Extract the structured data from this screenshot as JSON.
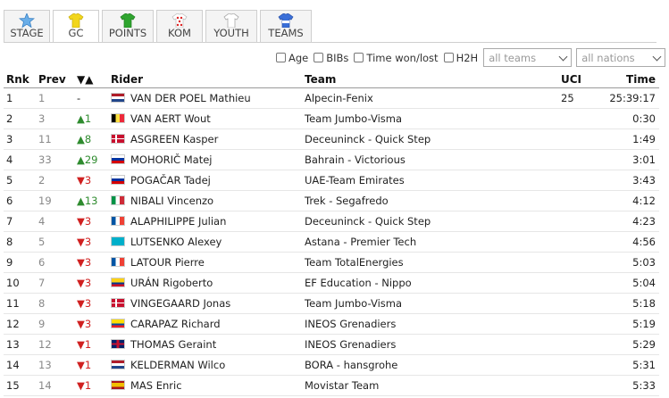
{
  "tabs": [
    {
      "label": "STAGE",
      "icon": "star-icon",
      "active": false
    },
    {
      "label": "GC",
      "icon": "yellow-jersey-icon",
      "active": true
    },
    {
      "label": "POINTS",
      "icon": "green-jersey-icon",
      "active": false
    },
    {
      "label": "KOM",
      "icon": "polka-dot-jersey-icon",
      "active": false
    },
    {
      "label": "YOUTH",
      "icon": "white-jersey-icon",
      "active": false
    },
    {
      "label": "TEAMS",
      "icon": "blue-jersey-icon",
      "active": false
    }
  ],
  "filters": {
    "age": "Age",
    "bibs": "BIBs",
    "time_won_lost": "Time won/lost",
    "h2h": "H2H",
    "teams_select": "all teams",
    "nations_select": "all nations"
  },
  "headers": {
    "rnk": "Rnk",
    "prev": "Prev",
    "diff": "▼▲",
    "rider": "Rider",
    "team": "Team",
    "uci": "UCI",
    "time": "Time"
  },
  "colors": {
    "up": "#2e8b2e",
    "down": "#d02020"
  },
  "rows": [
    {
      "rnk": "1",
      "prev": "1",
      "diff": "-",
      "dir": "none",
      "flag": "nl",
      "rider": "VAN DER POEL Mathieu",
      "team": "Alpecin-Fenix",
      "uci": "25",
      "time": "25:39:17"
    },
    {
      "rnk": "2",
      "prev": "3",
      "diff": "▲1",
      "dir": "up",
      "flag": "be",
      "rider": "VAN AERT Wout",
      "team": "Team Jumbo-Visma",
      "uci": "",
      "time": "0:30"
    },
    {
      "rnk": "3",
      "prev": "11",
      "diff": "▲8",
      "dir": "up",
      "flag": "dk",
      "rider": "ASGREEN Kasper",
      "team": "Deceuninck - Quick Step",
      "uci": "",
      "time": "1:49"
    },
    {
      "rnk": "4",
      "prev": "33",
      "diff": "▲29",
      "dir": "up",
      "flag": "si",
      "rider": "MOHORIČ Matej",
      "team": "Bahrain - Victorious",
      "uci": "",
      "time": "3:01"
    },
    {
      "rnk": "5",
      "prev": "2",
      "diff": "▼3",
      "dir": "down",
      "flag": "si",
      "rider": "POGAČAR Tadej",
      "team": "UAE-Team Emirates",
      "uci": "",
      "time": "3:43"
    },
    {
      "rnk": "6",
      "prev": "19",
      "diff": "▲13",
      "dir": "up",
      "flag": "it",
      "rider": "NIBALI Vincenzo",
      "team": "Trek - Segafredo",
      "uci": "",
      "time": "4:12"
    },
    {
      "rnk": "7",
      "prev": "4",
      "diff": "▼3",
      "dir": "down",
      "flag": "fr",
      "rider": "ALAPHILIPPE Julian",
      "team": "Deceuninck - Quick Step",
      "uci": "",
      "time": "4:23"
    },
    {
      "rnk": "8",
      "prev": "5",
      "diff": "▼3",
      "dir": "down",
      "flag": "kz",
      "rider": "LUTSENKO Alexey",
      "team": "Astana - Premier Tech",
      "uci": "",
      "time": "4:56"
    },
    {
      "rnk": "9",
      "prev": "6",
      "diff": "▼3",
      "dir": "down",
      "flag": "fr",
      "rider": "LATOUR Pierre",
      "team": "Team TotalEnergies",
      "uci": "",
      "time": "5:03"
    },
    {
      "rnk": "10",
      "prev": "7",
      "diff": "▼3",
      "dir": "down",
      "flag": "co",
      "rider": "URÁN Rigoberto",
      "team": "EF Education - Nippo",
      "uci": "",
      "time": "5:04"
    },
    {
      "rnk": "11",
      "prev": "8",
      "diff": "▼3",
      "dir": "down",
      "flag": "dk",
      "rider": "VINGEGAARD Jonas",
      "team": "Team Jumbo-Visma",
      "uci": "",
      "time": "5:18"
    },
    {
      "rnk": "12",
      "prev": "9",
      "diff": "▼3",
      "dir": "down",
      "flag": "ec",
      "rider": "CARAPAZ Richard",
      "team": "INEOS Grenadiers",
      "uci": "",
      "time": "5:19"
    },
    {
      "rnk": "13",
      "prev": "12",
      "diff": "▼1",
      "dir": "down",
      "flag": "gb",
      "rider": "THOMAS Geraint",
      "team": "INEOS Grenadiers",
      "uci": "",
      "time": "5:29"
    },
    {
      "rnk": "14",
      "prev": "13",
      "diff": "▼1",
      "dir": "down",
      "flag": "nl",
      "rider": "KELDERMAN Wilco",
      "team": "BORA - hansgrohe",
      "uci": "",
      "time": "5:31"
    },
    {
      "rnk": "15",
      "prev": "14",
      "diff": "▼1",
      "dir": "down",
      "flag": "es",
      "rider": "MAS Enric",
      "team": "Movistar Team",
      "uci": "",
      "time": "5:33"
    }
  ]
}
